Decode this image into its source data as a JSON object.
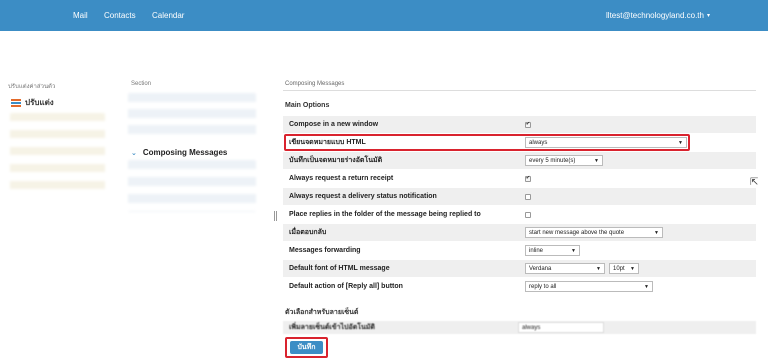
{
  "nav": {
    "mail": "Mail",
    "contacts": "Contacts",
    "calendar": "Calendar"
  },
  "user": {
    "email": "lltest@technologyland.co.th",
    "caret": "▾"
  },
  "settings_panel": {
    "title": "ปรับแต่งค่าส่วนตัว",
    "item": "ปรับแต่ง"
  },
  "section_panel": {
    "title": "Section",
    "active_item": "Composing Messages"
  },
  "main": {
    "header": "Composing Messages",
    "main_options_title": "Main Options",
    "rows": [
      {
        "label": "Compose in a new window",
        "type": "checkbox",
        "checked": true
      },
      {
        "label": "เขียนจดหมายแบบ HTML",
        "type": "select",
        "value": "always"
      },
      {
        "label": "บันทึกเป็นจดหมายร่างอัตโนมัติ",
        "type": "select",
        "value": "every 5 minute(s)"
      },
      {
        "label": "Always request a return receipt",
        "type": "checkbox",
        "checked": true
      },
      {
        "label": "Always request a delivery status notification",
        "type": "checkbox",
        "checked": false
      },
      {
        "label": "Place replies in the folder of the message being replied to",
        "type": "checkbox",
        "checked": false
      },
      {
        "label": "เมื่อตอบกลับ",
        "type": "select",
        "value": "start new message above the quote"
      },
      {
        "label": "Messages forwarding",
        "type": "select",
        "value": "inline"
      },
      {
        "label": "Default font of HTML message",
        "type": "select",
        "value": "Verdana",
        "extra": "10pt"
      },
      {
        "label": "Default action of [Reply all] button",
        "type": "select",
        "value": "reply to all"
      }
    ],
    "signature_title": "ตัวเลือกสำหรับลายเซ็นต์",
    "signature_row": {
      "label": "เพิ่มลายเซ็นต์เข้าไปอัตโนมัติ",
      "value": "always"
    },
    "save_label": "บันทึก"
  },
  "icons": {
    "check": "✔",
    "dropdown": "▼",
    "chevron": "⌄",
    "cursor": "⇱"
  },
  "colors": {
    "topbar": "#3c8dc5",
    "highlight": "#d9232e",
    "button": "#3c8dc5"
  }
}
